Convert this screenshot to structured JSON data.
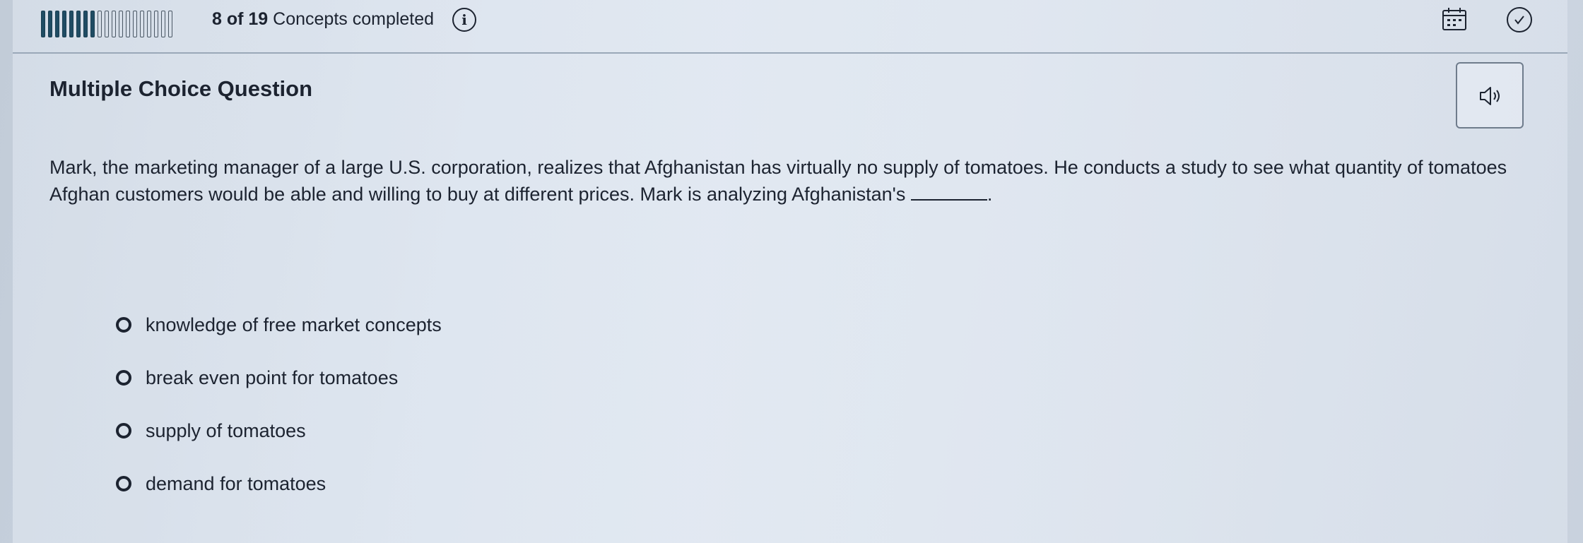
{
  "progress": {
    "completed": 8,
    "total": 19,
    "count_text": "8 of 19",
    "suffix": "Concepts completed"
  },
  "icons": {
    "info": "info-icon",
    "calendar": "calendar-icon",
    "check": "checkmark-circle-icon",
    "audio": "speaker-icon",
    "radio": "radio-button-icon"
  },
  "question": {
    "type_label": "Multiple Choice Question",
    "text": "Mark, the marketing manager of a large U.S. corporation, realizes that Afghanistan has virtually no supply of tomatoes. He conducts a study to see what quantity of tomatoes Afghan customers would be able and willing to buy at different prices. Mark is analyzing Afghanistan's",
    "text_end": "."
  },
  "options": [
    {
      "label": "knowledge of free market concepts"
    },
    {
      "label": "break even point for tomatoes"
    },
    {
      "label": "supply of tomatoes"
    },
    {
      "label": "demand for tomatoes"
    }
  ],
  "colors": {
    "progress_done": "#1f4c63",
    "text": "#1c2330",
    "background": "#d5dde8"
  }
}
